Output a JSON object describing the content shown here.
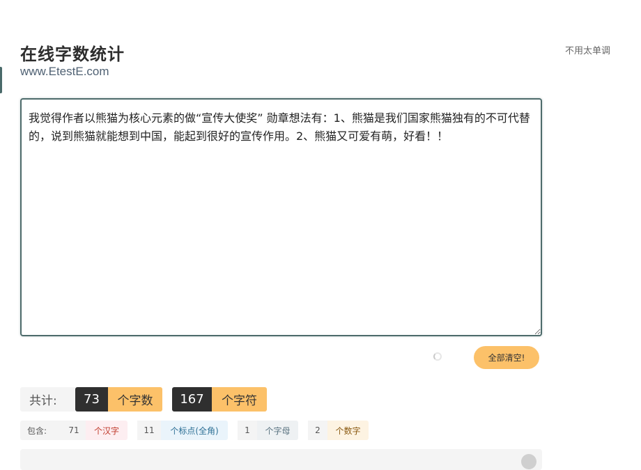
{
  "header": {
    "title": "在线字数统计",
    "url": "www.EtestE.com",
    "top_right_link": "不用太单调"
  },
  "editor": {
    "text": "我觉得作者以熊猫为核心元素的做“宣传大使奖” 勋章想法有：1、熊猫是我们国家熊猫独有的不可代替的，说到熊猫就能想到中国，能起到很好的宣传作用。2、熊猫又可爱有萌，好看！！"
  },
  "actions": {
    "clear_label": "全部清空!"
  },
  "totals": {
    "label": "共计:",
    "char_count": "73",
    "char_unit": "个字数",
    "symbol_count": "167",
    "symbol_unit": "个字符"
  },
  "breakdown": {
    "label": "包含:",
    "items": [
      {
        "count": "71",
        "unit": "个汉字",
        "color": "#c0392b",
        "bg": "#fdeef1"
      },
      {
        "count": "11",
        "unit": "个标点(全角)",
        "color": "#2d6f95",
        "bg": "#eaf4fb"
      },
      {
        "count": "1",
        "unit": "个字母",
        "color": "#5a7381",
        "bg": "#eef1f3"
      },
      {
        "count": "2",
        "unit": "个数字",
        "color": "#8a5a12",
        "bg": "#fdf3e2"
      }
    ]
  }
}
